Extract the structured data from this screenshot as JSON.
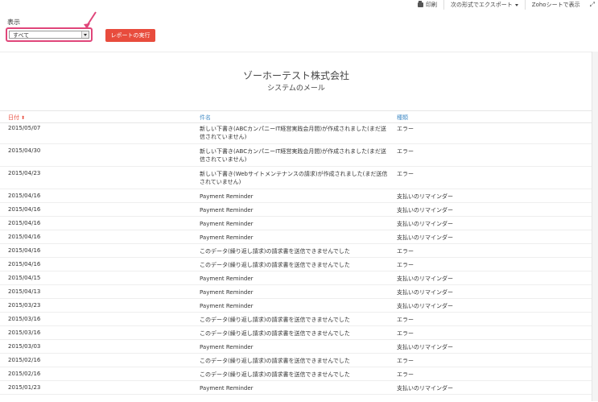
{
  "toolbar": {
    "print_label": "印刷",
    "export_label": "次の形式でエクスポート",
    "zoho_sheet_label": "Zohoシートで表示"
  },
  "filter": {
    "label": "表示",
    "selected": "すべて"
  },
  "run_report_label": "レポートの実行",
  "report": {
    "company": "ゾーホーテスト株式会社",
    "name": "システムのメール"
  },
  "table": {
    "headers": {
      "date": "日付",
      "subject": "件名",
      "type": "種類"
    },
    "rows": [
      {
        "date": "2015/05/07",
        "subject": "新しい下書き(ABCカンパニーIT経営実践会月間)が作成されました(まだ送信されていません)",
        "type": "エラー"
      },
      {
        "date": "2015/04/30",
        "subject": "新しい下書き(ABCカンパニーIT経営実践会月間)が作成されました(まだ送信されていません)",
        "type": "エラー"
      },
      {
        "date": "2015/04/23",
        "subject": "新しい下書き(Webサイトメンテナンスの請求)が作成されました(まだ送信されていません)",
        "type": "エラー"
      },
      {
        "date": "2015/04/16",
        "subject": "Payment Reminder",
        "type": "支払いのリマインダー"
      },
      {
        "date": "2015/04/16",
        "subject": "Payment Reminder",
        "type": "支払いのリマインダー"
      },
      {
        "date": "2015/04/16",
        "subject": "Payment Reminder",
        "type": "支払いのリマインダー"
      },
      {
        "date": "2015/04/16",
        "subject": "Payment Reminder",
        "type": "支払いのリマインダー"
      },
      {
        "date": "2015/04/16",
        "subject": "このデータ(繰り返し請求)の請求書を送信できませんでした",
        "type": "エラー"
      },
      {
        "date": "2015/04/16",
        "subject": "このデータ(繰り返し請求)の請求書を送信できませんでした",
        "type": "エラー"
      },
      {
        "date": "2015/04/15",
        "subject": "Payment Reminder",
        "type": "支払いのリマインダー"
      },
      {
        "date": "2015/04/13",
        "subject": "Payment Reminder",
        "type": "支払いのリマインダー"
      },
      {
        "date": "2015/03/23",
        "subject": "Payment Reminder",
        "type": "支払いのリマインダー"
      },
      {
        "date": "2015/03/16",
        "subject": "このデータ(繰り返し請求)の請求書を送信できませんでした",
        "type": "エラー"
      },
      {
        "date": "2015/03/16",
        "subject": "このデータ(繰り返し請求)の請求書を送信できませんでした",
        "type": "エラー"
      },
      {
        "date": "2015/03/03",
        "subject": "Payment Reminder",
        "type": "支払いのリマインダー"
      },
      {
        "date": "2015/02/16",
        "subject": "このデータ(繰り返し請求)の請求書を送信できませんでした",
        "type": "エラー"
      },
      {
        "date": "2015/02/16",
        "subject": "このデータ(繰り返し請求)の請求書を送信できませんでした",
        "type": "エラー"
      },
      {
        "date": "2015/01/23",
        "subject": "Payment Reminder",
        "type": "支払いのリマインダー"
      }
    ]
  },
  "colors": {
    "accent": "#e84c3d",
    "header_link": "#4a90c8",
    "highlight": "#e0467a"
  }
}
